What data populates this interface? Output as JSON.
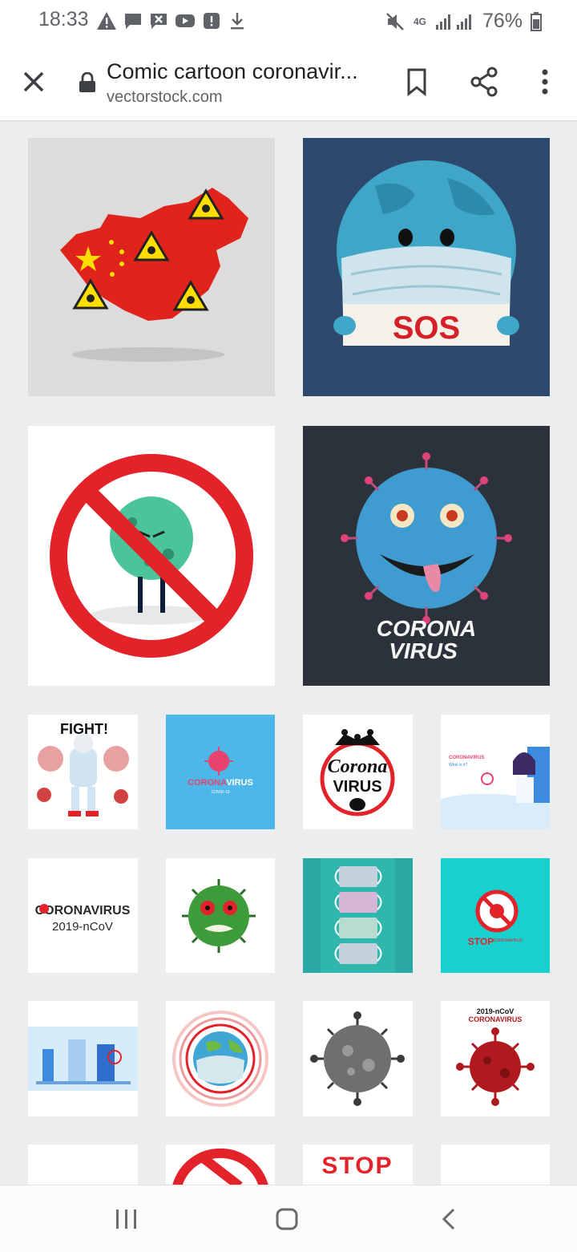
{
  "status_bar": {
    "time": "18:33",
    "network": "4G",
    "battery": "76%",
    "icons_left": [
      "warning-icon",
      "chat-icon",
      "mail-x-icon",
      "youtube-icon",
      "alert-icon",
      "download-icon"
    ],
    "icons_right": [
      "mute-icon",
      "signal-icon",
      "battery-icon"
    ]
  },
  "toolbar": {
    "title": "Comic cartoon coronavir...",
    "url": "vectorstock.com",
    "close_icon": "close-icon",
    "bookmark_icon": "bookmark-icon",
    "share_icon": "share-icon",
    "more_icon": "more-vert-icon"
  },
  "images": {
    "china": {
      "texts": []
    },
    "sos": {
      "text": "SOS"
    },
    "no_virus": {
      "texts": []
    },
    "monster": {
      "line1": "CORONA",
      "line2": "VIRUS"
    },
    "fight": {
      "text": "FIGHT!"
    },
    "coronavirus_blue": {
      "text_a": "CORONA",
      "text_b": "VIRUS",
      "sub": "COVID-19"
    },
    "corona_crown": {
      "line1": "Corona",
      "line2": "VIRUS"
    },
    "doctor_info": {
      "title": "CORONAVIRUS",
      "sub": "What is it?"
    },
    "ncov_text": {
      "line1": "CORONAVIRUS",
      "line2": "2019-nCoV"
    },
    "stop_teal": {
      "text": "STOP",
      "sub": "CORONAVIRUS"
    },
    "virus_red": {
      "line1": "2019-nCoV",
      "line2": "CORONAVIRUS"
    },
    "stop_bottom": {
      "text": "STOP"
    }
  },
  "colors": {
    "accent_red": "#e4222a",
    "navy": "#2d4a6e",
    "teal": "#18d0cf",
    "blue": "#4cb7e8"
  },
  "navbar": {
    "recents": "recents-icon",
    "home": "home-icon",
    "back": "back-icon"
  }
}
